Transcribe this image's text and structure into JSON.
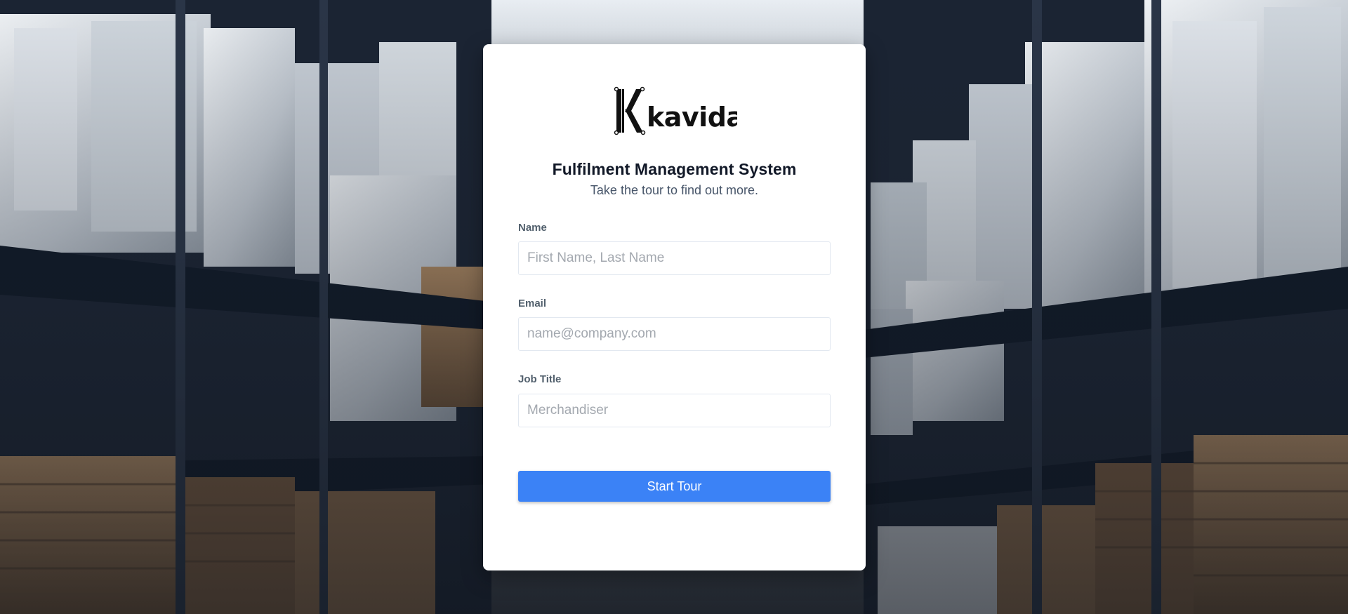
{
  "brand": {
    "logo_text": "kavida",
    "icon_name": "kavida-k-logo-icon"
  },
  "form": {
    "title": "Fulfilment Management System",
    "subtitle": "Take the tour to find out more.",
    "fields": [
      {
        "label": "Name",
        "value": "",
        "placeholder": "First Name, Last Name"
      },
      {
        "label": "Email",
        "value": "",
        "placeholder": "name@company.com"
      },
      {
        "label": "Job Title",
        "value": "",
        "placeholder": "Merchandiser"
      }
    ],
    "submit_label": "Start Tour"
  },
  "colors": {
    "accent": "#3b82f6",
    "title": "#111827",
    "label": "#52606d",
    "card": "#ffffff"
  }
}
